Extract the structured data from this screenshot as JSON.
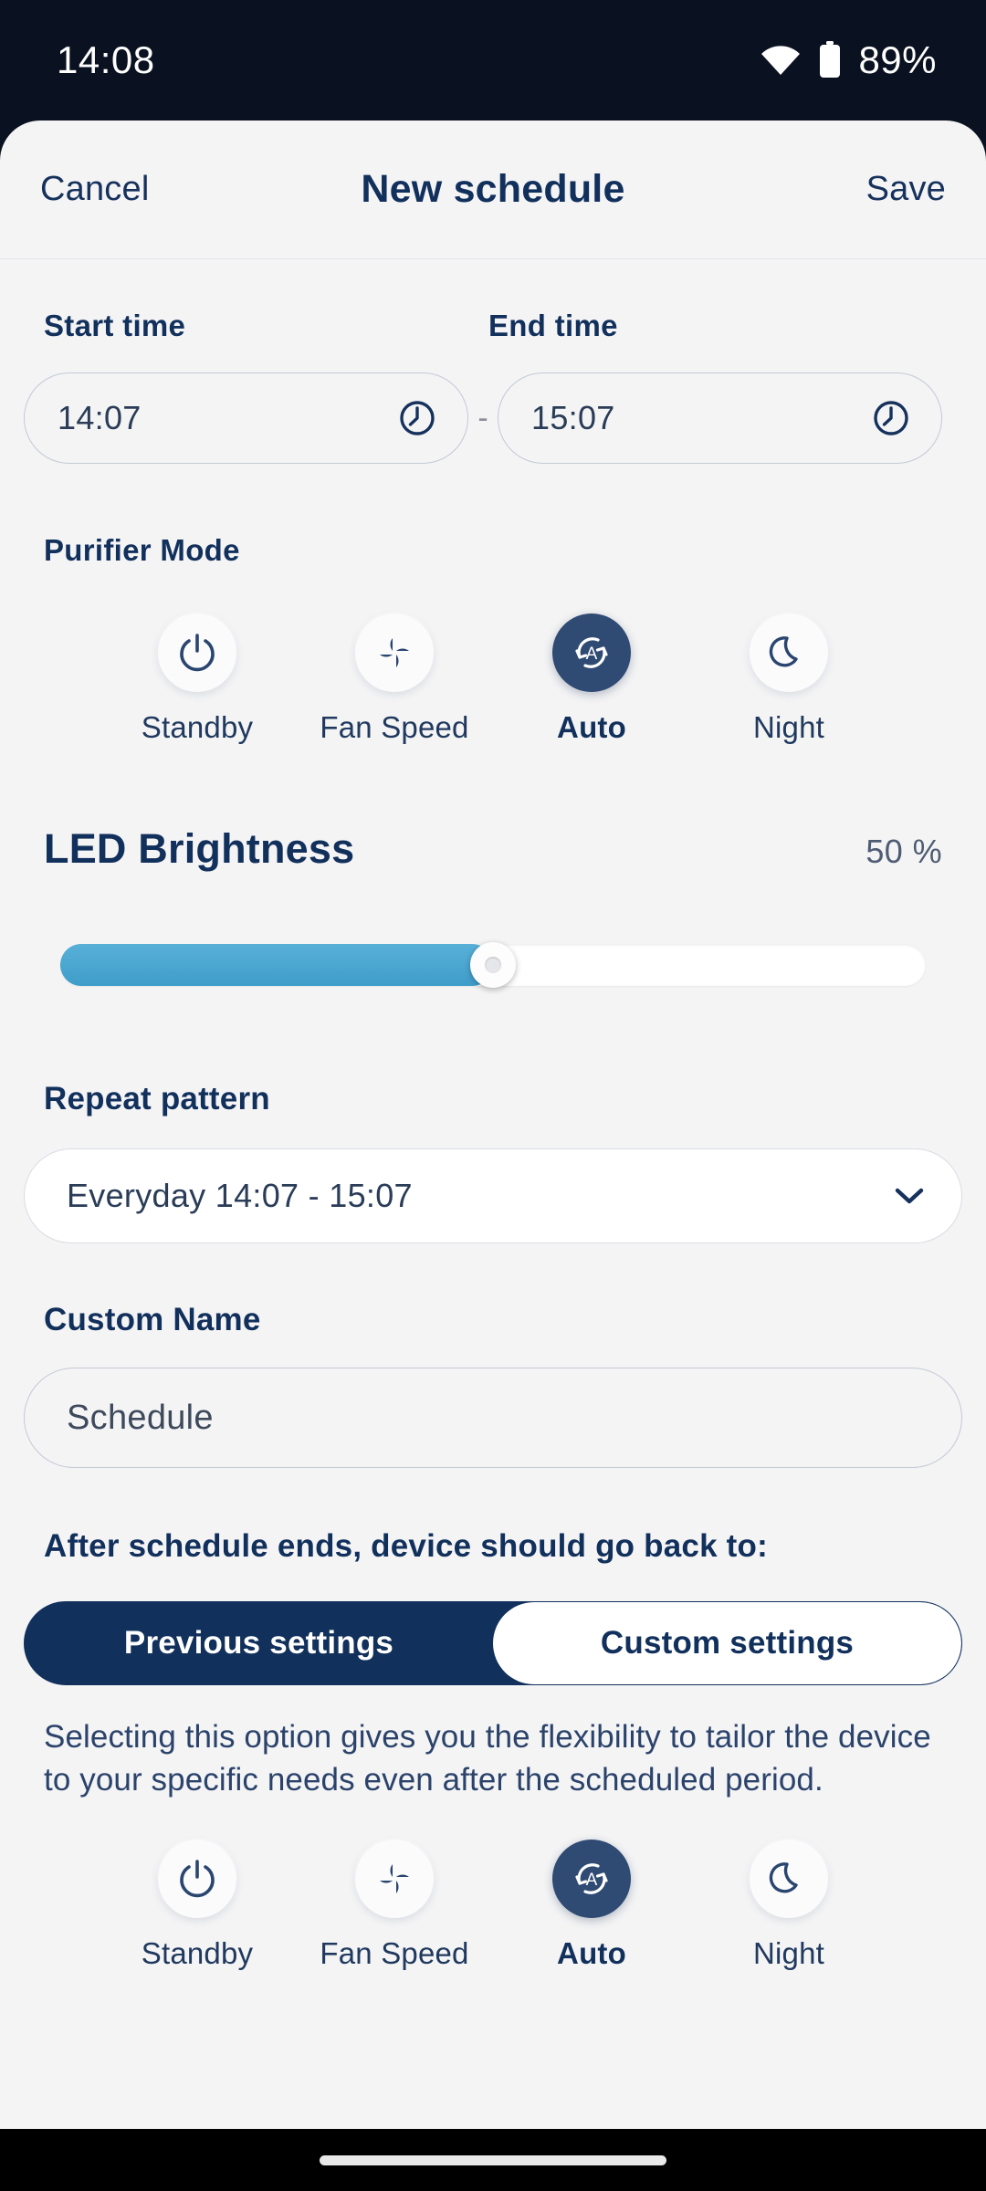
{
  "status_bar": {
    "time": "14:08",
    "battery_pct": "89%",
    "wifi_icon": "wifi-icon",
    "battery_icon": "battery-icon"
  },
  "header": {
    "cancel_label": "Cancel",
    "title": "New schedule",
    "save_label": "Save"
  },
  "time_section": {
    "start_label": "Start time",
    "end_label": "End time",
    "start_value": "14:07",
    "end_value": "15:07",
    "separator": "-",
    "clock_icon": "clock-icon"
  },
  "purifier_mode": {
    "section_label": "Purifier Mode",
    "modes": [
      {
        "label": "Standby",
        "icon": "power-icon",
        "selected": false
      },
      {
        "label": "Fan Speed",
        "icon": "fan-icon",
        "selected": false
      },
      {
        "label": "Auto",
        "icon": "auto-icon",
        "selected": true
      },
      {
        "label": "Night",
        "icon": "moon-icon",
        "selected": false
      }
    ]
  },
  "led_brightness": {
    "title": "LED Brightness",
    "value_label": "50 %",
    "value": 50,
    "fill_color": "#3f9dc9"
  },
  "repeat_pattern": {
    "label": "Repeat pattern",
    "selected_value": "Everyday 14:07 - 15:07",
    "chevron_icon": "chevron-down-icon"
  },
  "custom_name": {
    "label": "Custom Name",
    "value": "Schedule",
    "placeholder": "Schedule"
  },
  "after_schedule": {
    "label": "After schedule ends, device should go back to:",
    "options": [
      {
        "label": "Previous settings",
        "selected": true
      },
      {
        "label": "Custom settings",
        "selected": false
      }
    ],
    "description": "Selecting this option gives you the flexibility to tailor the device to your specific needs even after the scheduled period.",
    "active_color": "#12305c"
  },
  "bottom_modes": [
    {
      "label": "Standby",
      "icon": "power-icon",
      "selected": false
    },
    {
      "label": "Fan Speed",
      "icon": "fan-icon",
      "selected": false
    },
    {
      "label": "Auto",
      "icon": "auto-icon",
      "selected": true
    },
    {
      "label": "Night",
      "icon": "moon-icon",
      "selected": false
    }
  ],
  "theme": {
    "navy": "#12305c",
    "background": "#f4f4f5",
    "status_bar_bg": "#0a1120",
    "slider_blue": "#3f9dc9",
    "selected_circle": "#2f4a73"
  }
}
